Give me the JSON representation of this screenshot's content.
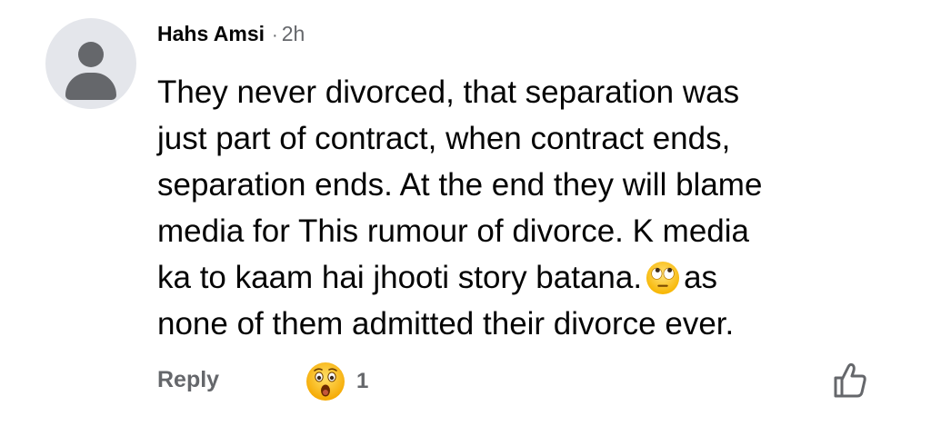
{
  "comment": {
    "author": "Hahs Amsi",
    "separator": "·",
    "time": "2h",
    "text_lines": [
      "They never divorced, that separation was",
      "just part of contract, when contract ends,",
      "separation ends. At the end they will blame",
      "media for This rumour of divorce. K media",
      "ka to kaam hai jhooti story batana.",
      "as",
      "none of them admitted their divorce ever."
    ],
    "inline_emoji": "face-with-rolling-eyes"
  },
  "actions": {
    "reply_label": "Reply",
    "reaction_emoji": "astonished-face",
    "reaction_count": "1",
    "like_icon": "thumbs-up-outline-icon"
  },
  "colors": {
    "avatar_bg": "#e4e6eb",
    "avatar_fg": "#65676b",
    "text": "#050505",
    "secondary": "#65676b"
  }
}
